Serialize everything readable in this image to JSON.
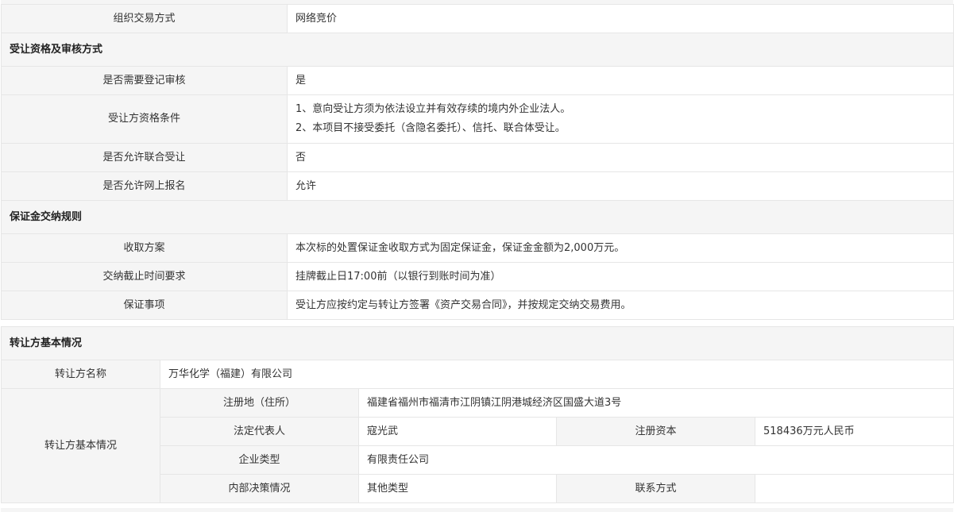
{
  "trade_method": {
    "label": "组织交易方式",
    "value": "网络竞价"
  },
  "qualification_section": {
    "title": "受让资格及审核方式",
    "rows": [
      {
        "label": "是否需要登记审核",
        "value": "是"
      },
      {
        "label": "受让方资格条件",
        "lines": [
          "1、意向受让方须为依法设立并有效存续的境内外企业法人。",
          "2、本项目不接受委托（含隐名委托）、信托、联合体受让。"
        ]
      },
      {
        "label": "是否允许联合受让",
        "value": "否"
      },
      {
        "label": "是否允许网上报名",
        "value": "允许"
      }
    ]
  },
  "deposit_section": {
    "title": "保证金交纳规则",
    "rows": [
      {
        "label": "收取方案",
        "value": "本次标的处置保证金收取方式为固定保证金，保证金金额为2,000万元。"
      },
      {
        "label": "交纳截止时间要求",
        "value": "挂牌截止日17:00前（以银行到账时间为准）"
      },
      {
        "label": "保证事项",
        "value": "受让方应按约定与转让方签署《资产交易合同》，并按规定交纳交易费用。"
      }
    ]
  },
  "transferor_section": {
    "title": "转让方基本情况",
    "name_label": "转让方名称",
    "name_value": "万华化学（福建）有限公司",
    "group_label": "转让方基本情况",
    "address_label": "注册地（住所）",
    "address_value": "福建省福州市福清市江阴镇江阴港城经济区国盛大道3号",
    "legal_rep_label": "法定代表人",
    "legal_rep_value": "寇光武",
    "capital_label": "注册资本",
    "capital_value": "518436万元人民币",
    "company_type_label": "企业类型",
    "company_type_value": "有限责任公司",
    "decision_label": "内部决策情况",
    "decision_value": "其他类型",
    "contact_label": "联系方式",
    "contact_value": ""
  }
}
